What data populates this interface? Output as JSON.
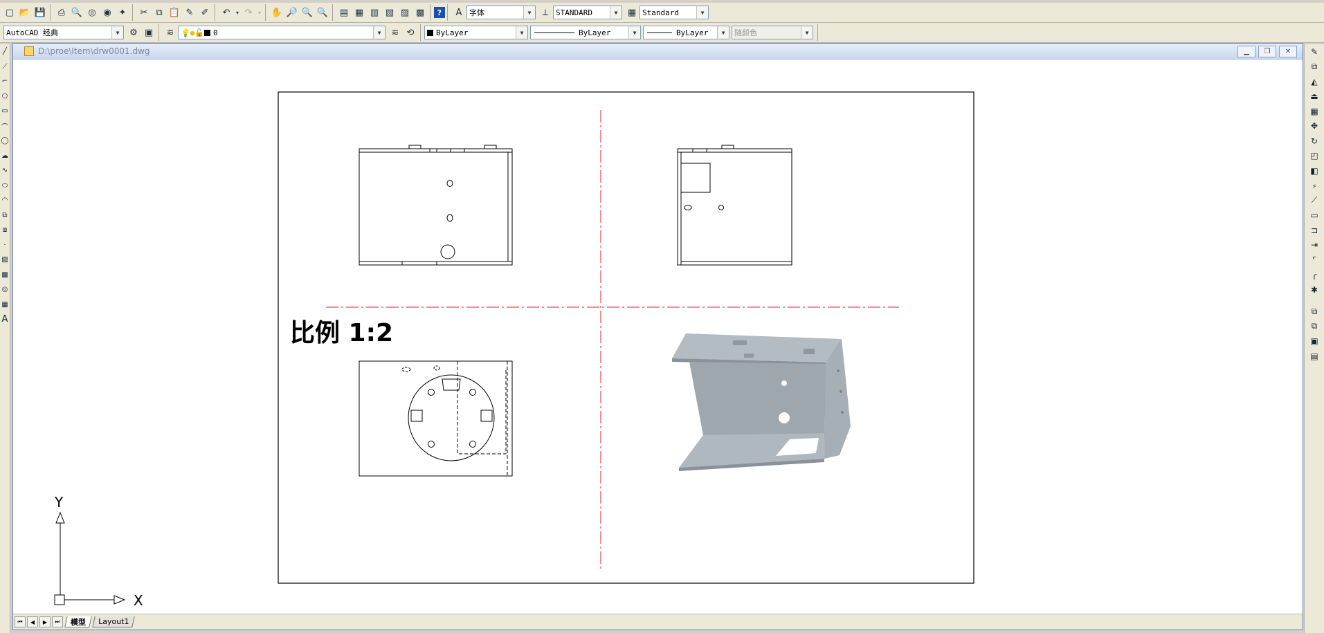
{
  "toolbar_row1": {
    "text_style": "字体",
    "dim_style": "STANDARD",
    "table_style": "Standard"
  },
  "toolbar_row2": {
    "workspace": "AutoCAD 经典",
    "layer": "0",
    "color": "ByLayer",
    "linetype": "ByLayer",
    "lineweight": "ByLayer",
    "plot_style": "随颜色"
  },
  "window": {
    "title": "D:\\proe\\Item\\drw0001.dwg"
  },
  "drawing": {
    "scale_note": "比例 1:2",
    "ucs_x": "X",
    "ucs_y": "Y"
  },
  "layout_tabs": {
    "model": "模型",
    "layout1": "Layout1"
  },
  "colors": {
    "centerline": "#e0202a",
    "part_shade": "#a8b0b8",
    "part_dark": "#8f979f"
  }
}
